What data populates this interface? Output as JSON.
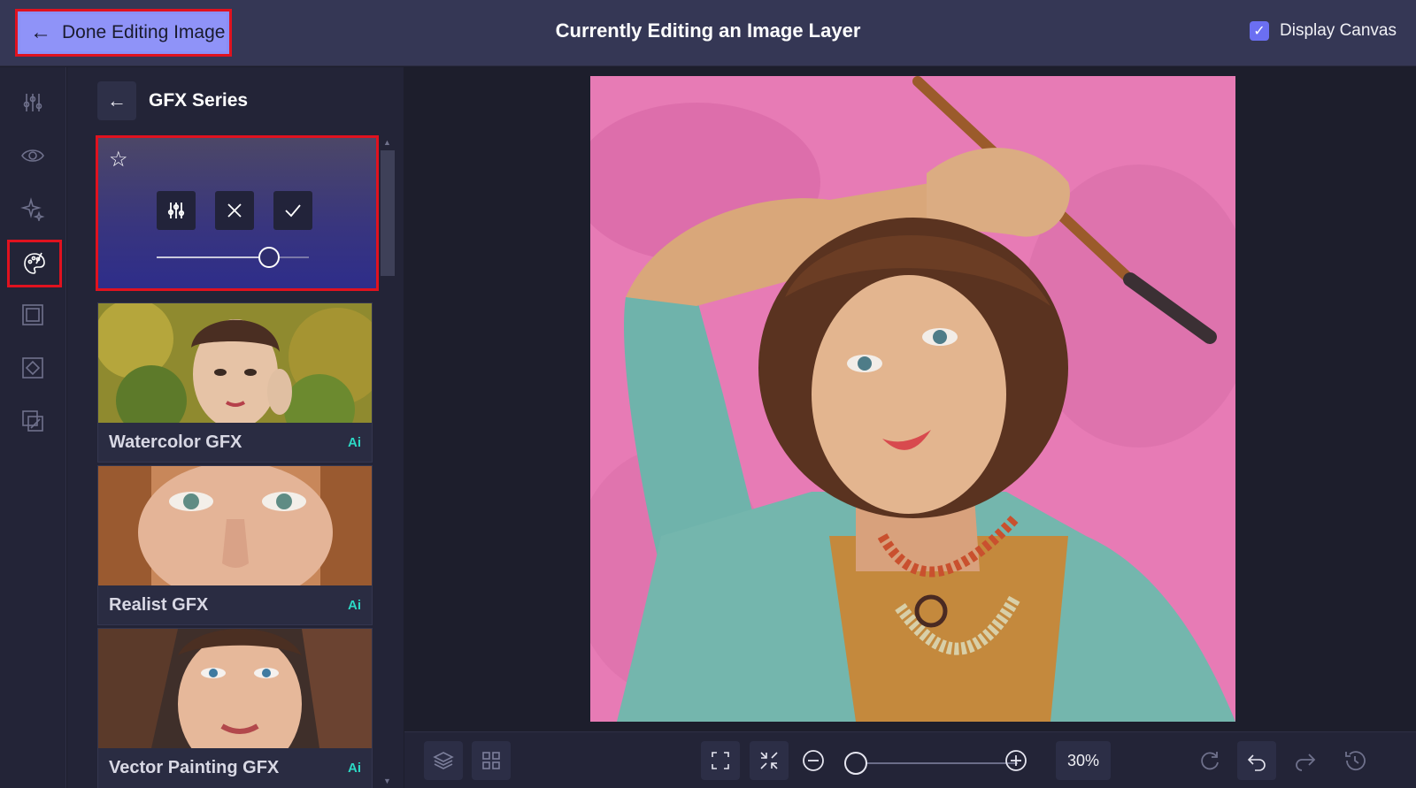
{
  "header": {
    "done_label": "Done Editing Image",
    "title": "Currently Editing an Image Layer",
    "display_canvas_label": "Display Canvas",
    "display_canvas_checked": true
  },
  "rail": {
    "items": [
      {
        "icon": "adjustments-icon",
        "active": false
      },
      {
        "icon": "eye-icon",
        "active": false
      },
      {
        "icon": "sparkle-icon",
        "active": false
      },
      {
        "icon": "palette-icon",
        "active": true
      },
      {
        "icon": "frame-icon",
        "active": false
      },
      {
        "icon": "crop-frame-icon",
        "active": false
      },
      {
        "icon": "overlay-icon",
        "active": false
      }
    ]
  },
  "panel": {
    "title": "GFX Series",
    "active_effect": {
      "intensity": 0.75
    },
    "styles": [
      {
        "name": "Watercolor GFX",
        "badge": "Ai"
      },
      {
        "name": "Realist GFX",
        "badge": "Ai"
      },
      {
        "name": "Vector Painting GFX",
        "badge": "Ai"
      }
    ]
  },
  "bottom": {
    "zoom": "30%"
  },
  "colors": {
    "accent": "#8f93f8",
    "highlight": "#e0121f",
    "ai_badge": "#2cd8c4",
    "canvas_pink": "#e87bb7"
  }
}
